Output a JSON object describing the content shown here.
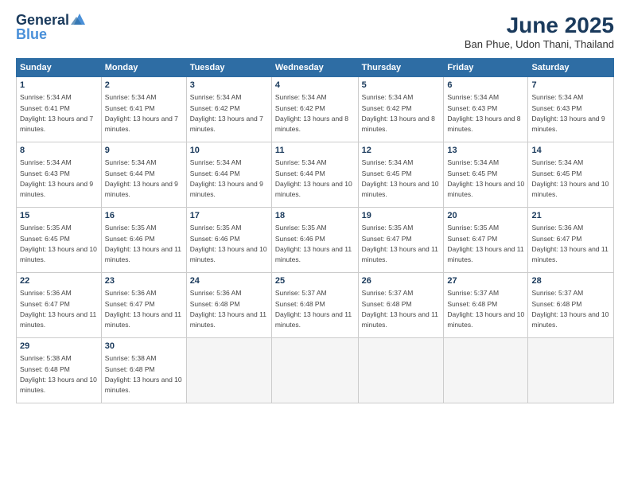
{
  "header": {
    "logo_line1": "General",
    "logo_line2": "Blue",
    "month": "June 2025",
    "location": "Ban Phue, Udon Thani, Thailand"
  },
  "days_of_week": [
    "Sunday",
    "Monday",
    "Tuesday",
    "Wednesday",
    "Thursday",
    "Friday",
    "Saturday"
  ],
  "weeks": [
    [
      {
        "day": 1,
        "sunrise": "5:34 AM",
        "sunset": "6:41 PM",
        "daylight": "13 hours and 7 minutes."
      },
      {
        "day": 2,
        "sunrise": "5:34 AM",
        "sunset": "6:41 PM",
        "daylight": "13 hours and 7 minutes."
      },
      {
        "day": 3,
        "sunrise": "5:34 AM",
        "sunset": "6:42 PM",
        "daylight": "13 hours and 7 minutes."
      },
      {
        "day": 4,
        "sunrise": "5:34 AM",
        "sunset": "6:42 PM",
        "daylight": "13 hours and 8 minutes."
      },
      {
        "day": 5,
        "sunrise": "5:34 AM",
        "sunset": "6:42 PM",
        "daylight": "13 hours and 8 minutes."
      },
      {
        "day": 6,
        "sunrise": "5:34 AM",
        "sunset": "6:43 PM",
        "daylight": "13 hours and 8 minutes."
      },
      {
        "day": 7,
        "sunrise": "5:34 AM",
        "sunset": "6:43 PM",
        "daylight": "13 hours and 9 minutes."
      }
    ],
    [
      {
        "day": 8,
        "sunrise": "5:34 AM",
        "sunset": "6:43 PM",
        "daylight": "13 hours and 9 minutes."
      },
      {
        "day": 9,
        "sunrise": "5:34 AM",
        "sunset": "6:44 PM",
        "daylight": "13 hours and 9 minutes."
      },
      {
        "day": 10,
        "sunrise": "5:34 AM",
        "sunset": "6:44 PM",
        "daylight": "13 hours and 9 minutes."
      },
      {
        "day": 11,
        "sunrise": "5:34 AM",
        "sunset": "6:44 PM",
        "daylight": "13 hours and 10 minutes."
      },
      {
        "day": 12,
        "sunrise": "5:34 AM",
        "sunset": "6:45 PM",
        "daylight": "13 hours and 10 minutes."
      },
      {
        "day": 13,
        "sunrise": "5:34 AM",
        "sunset": "6:45 PM",
        "daylight": "13 hours and 10 minutes."
      },
      {
        "day": 14,
        "sunrise": "5:34 AM",
        "sunset": "6:45 PM",
        "daylight": "13 hours and 10 minutes."
      }
    ],
    [
      {
        "day": 15,
        "sunrise": "5:35 AM",
        "sunset": "6:45 PM",
        "daylight": "13 hours and 10 minutes."
      },
      {
        "day": 16,
        "sunrise": "5:35 AM",
        "sunset": "6:46 PM",
        "daylight": "13 hours and 11 minutes."
      },
      {
        "day": 17,
        "sunrise": "5:35 AM",
        "sunset": "6:46 PM",
        "daylight": "13 hours and 10 minutes."
      },
      {
        "day": 18,
        "sunrise": "5:35 AM",
        "sunset": "6:46 PM",
        "daylight": "13 hours and 11 minutes."
      },
      {
        "day": 19,
        "sunrise": "5:35 AM",
        "sunset": "6:47 PM",
        "daylight": "13 hours and 11 minutes."
      },
      {
        "day": 20,
        "sunrise": "5:35 AM",
        "sunset": "6:47 PM",
        "daylight": "13 hours and 11 minutes."
      },
      {
        "day": 21,
        "sunrise": "5:36 AM",
        "sunset": "6:47 PM",
        "daylight": "13 hours and 11 minutes."
      }
    ],
    [
      {
        "day": 22,
        "sunrise": "5:36 AM",
        "sunset": "6:47 PM",
        "daylight": "13 hours and 11 minutes."
      },
      {
        "day": 23,
        "sunrise": "5:36 AM",
        "sunset": "6:47 PM",
        "daylight": "13 hours and 11 minutes."
      },
      {
        "day": 24,
        "sunrise": "5:36 AM",
        "sunset": "6:48 PM",
        "daylight": "13 hours and 11 minutes."
      },
      {
        "day": 25,
        "sunrise": "5:37 AM",
        "sunset": "6:48 PM",
        "daylight": "13 hours and 11 minutes."
      },
      {
        "day": 26,
        "sunrise": "5:37 AM",
        "sunset": "6:48 PM",
        "daylight": "13 hours and 11 minutes."
      },
      {
        "day": 27,
        "sunrise": "5:37 AM",
        "sunset": "6:48 PM",
        "daylight": "13 hours and 10 minutes."
      },
      {
        "day": 28,
        "sunrise": "5:37 AM",
        "sunset": "6:48 PM",
        "daylight": "13 hours and 10 minutes."
      }
    ],
    [
      {
        "day": 29,
        "sunrise": "5:38 AM",
        "sunset": "6:48 PM",
        "daylight": "13 hours and 10 minutes."
      },
      {
        "day": 30,
        "sunrise": "5:38 AM",
        "sunset": "6:48 PM",
        "daylight": "13 hours and 10 minutes."
      },
      null,
      null,
      null,
      null,
      null
    ]
  ]
}
